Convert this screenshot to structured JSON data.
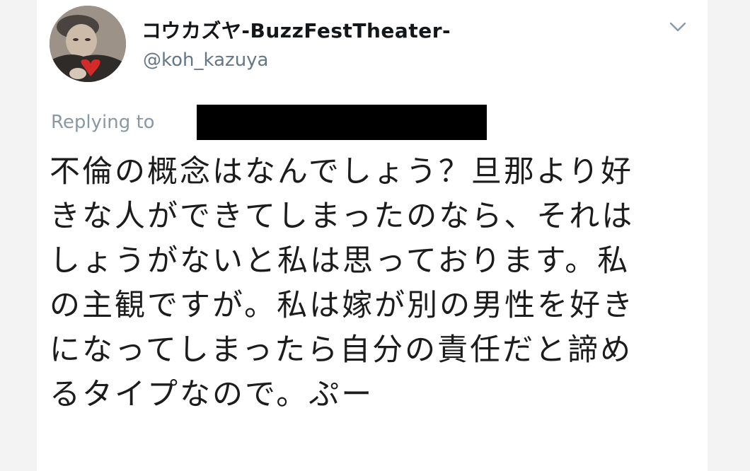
{
  "tweet": {
    "display_name": "コウカズヤ-BuzzFestTheater-",
    "handle": "@koh_kazuya",
    "replying_to_label": "Replying to",
    "lines": [
      "不倫の概念はなんでしょう？旦那より好",
      "きな人ができてしまったのなら、それは",
      "しょうがないと私は思っております。私",
      "の主観ですが。私は嫁が別の男性を好き",
      "になってしまったら自分の責任だと諦め",
      "るタイプなので。ぷー"
    ]
  },
  "icons": {
    "menu": "chevron-down-icon",
    "avatar": "profile-photo"
  },
  "colors": {
    "name": "#14171a",
    "handle": "#657786",
    "reply_label": "#8899a6",
    "text": "#1c1c1c",
    "redaction": "#000000"
  }
}
